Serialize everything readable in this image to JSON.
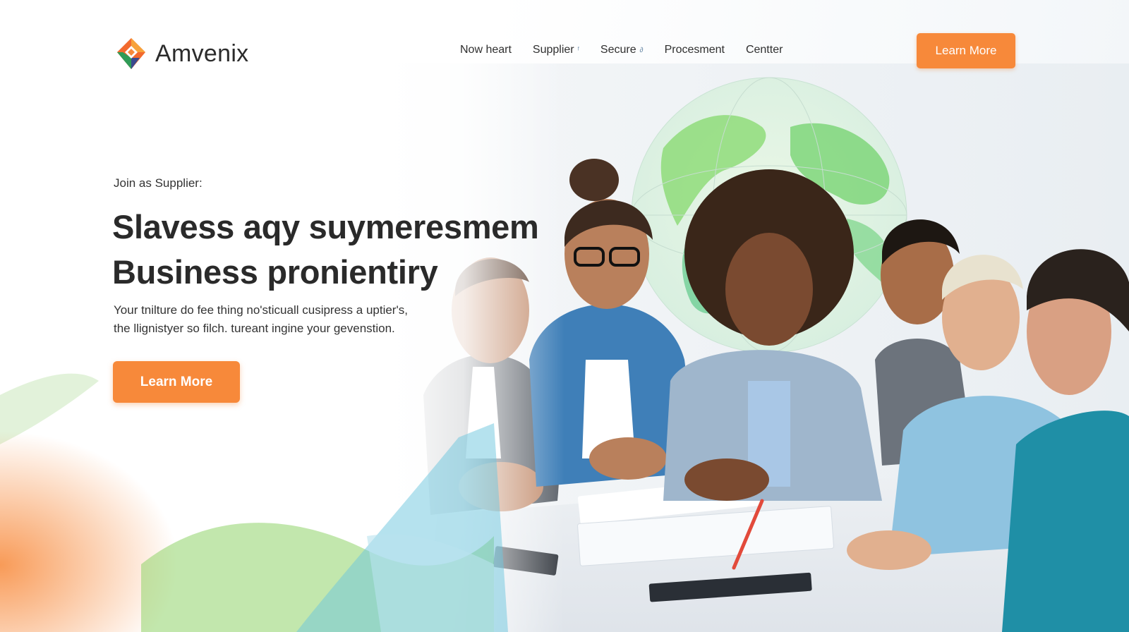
{
  "brand": {
    "name": "Amvenix",
    "logo_icon": "diamond-logo-icon"
  },
  "nav": {
    "items": [
      {
        "label": "Now heart"
      },
      {
        "label": "Supplier"
      },
      {
        "label": "Secure"
      },
      {
        "label": "Procesment"
      },
      {
        "label": "Centter"
      }
    ]
  },
  "header": {
    "cta_label": "Learn More"
  },
  "hero": {
    "eyebrow": "Join as Supplier:",
    "headline_line1": "Slavess aqy suymeresmem",
    "headline_line2": "Business pronientiry",
    "subtext_line1": "Your tnilture do fee thing no'sticuall cusipress a uptier's,",
    "subtext_line2": "the llignistyer so filch. tureant ingine your gevenstion.",
    "cta_label": "Learn More",
    "photo_subject": "team-meeting-photo",
    "globe_icon": "globe-icon"
  },
  "colors": {
    "accent": "#f7893a",
    "text": "#2a2a2a",
    "globe_green": "#7fd67a",
    "suit_blue": "#3f7fb8"
  }
}
